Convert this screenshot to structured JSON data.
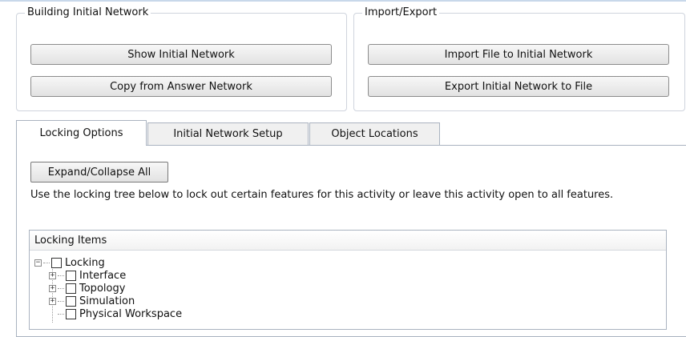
{
  "building_group": {
    "title": "Building Initial Network",
    "show_button": "Show Initial Network",
    "copy_button": "Copy from Answer Network"
  },
  "import_group": {
    "title": "Import/Export",
    "import_button": "Import File to Initial Network",
    "export_button": "Export Initial Network to File"
  },
  "tabs": [
    {
      "label": "Locking Options",
      "active": true
    },
    {
      "label": "Initial Network Setup",
      "active": false
    },
    {
      "label": "Object Locations",
      "active": false
    }
  ],
  "locking": {
    "expand_button": "Expand/Collapse All",
    "description": "Use the locking tree below to lock out certain features for this activity or leave this activity open to all features.",
    "tree_header": "Locking Items",
    "root": {
      "label": "Locking",
      "expander": "−",
      "checked": false
    },
    "children": [
      {
        "label": "Interface",
        "expander": "+",
        "checked": false
      },
      {
        "label": "Topology",
        "expander": "+",
        "checked": false
      },
      {
        "label": "Simulation",
        "expander": "+",
        "checked": false
      },
      {
        "label": "Physical Workspace",
        "expander": "",
        "checked": false
      }
    ]
  }
}
